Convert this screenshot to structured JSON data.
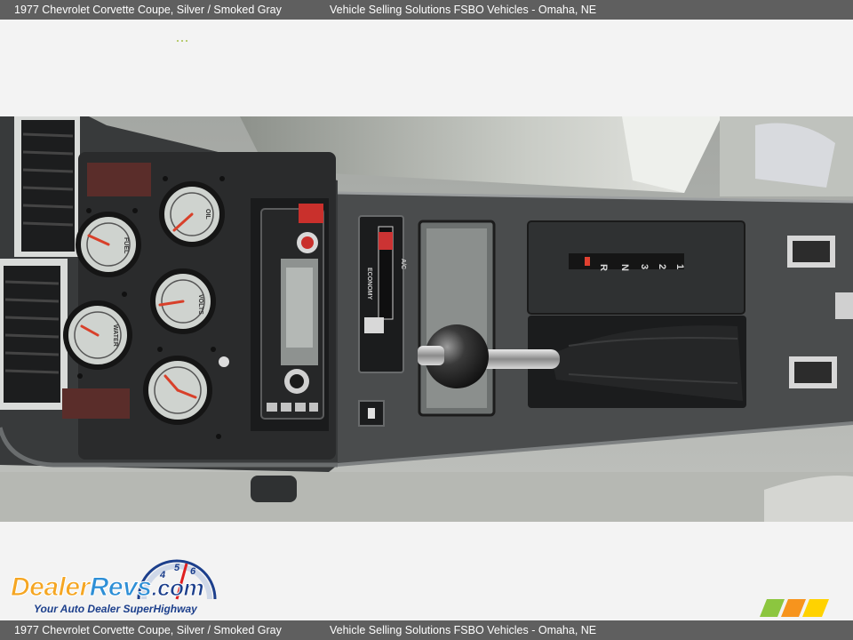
{
  "header": {
    "title": "1977 Chevrolet Corvette Coupe,  Silver / Smoked Gray",
    "dealer": "Vehicle Selling Solutions FSBO Vehicles - Omaha, NE"
  },
  "footer": {
    "title": "1977 Chevrolet Corvette Coupe,  Silver / Smoked Gray",
    "dealer": "Vehicle Selling Solutions FSBO Vehicles - Omaha, NE"
  },
  "logo": {
    "word_part1": "Dealer",
    "word_part2": "Revs",
    "word_part3": ".com",
    "tagline": "Your Auto Dealer SuperHighway",
    "gauge_digits": [
      "4",
      "5",
      "6"
    ]
  },
  "photo": {
    "gauge_labels": [
      "FUEL",
      "OIL",
      "WATER",
      "AMP",
      "VOLTS"
    ],
    "shifter_positions": [
      "P",
      "R",
      "N",
      "D",
      "3",
      "2",
      "1"
    ],
    "hvac_label": "ECONOMY",
    "hvac_label_2": "A/C"
  },
  "colors": {
    "bar_bg": "#5f5f5f",
    "logo_orange": "#f5a623",
    "logo_blue": "#2e8fd6",
    "logo_navy": "#1c3f8c",
    "stripe_colors": [
      "#8cc63f",
      "#f7941d",
      "#ffd200"
    ]
  }
}
